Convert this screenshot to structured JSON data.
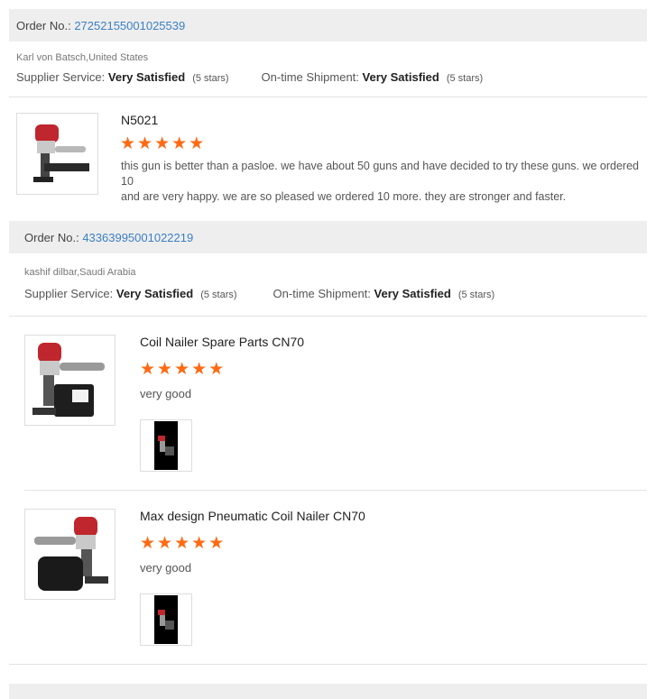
{
  "orders": [
    {
      "order_label": "Order No.:",
      "order_number": "27252155001025539",
      "buyer": "Karl von Batsch,United States",
      "supplier_label": "Supplier Service:",
      "supplier_value": "Very Satisfied",
      "supplier_stars": "(5 stars)",
      "shipment_label": "On-time Shipment:",
      "shipment_value": "Very Satisfied",
      "shipment_stars": "(5 stars)",
      "products": [
        {
          "name": "N5021",
          "rating": 5,
          "review_lines": [
            "this gun is better than a pasloe. we have about 50 guns and have decided to try these guns. we ordered 10",
            "and are very happy. we are so pleased we ordered 10 more. they are stronger and faster."
          ]
        }
      ]
    },
    {
      "order_label": "Order No.:",
      "order_number": "43363995001022219",
      "buyer": "kashif dilbar,Saudi Arabia",
      "supplier_label": "Supplier Service:",
      "supplier_value": "Very Satisfied",
      "supplier_stars": "(5 stars)",
      "shipment_label": "On-time Shipment:",
      "shipment_value": "Very Satisfied",
      "shipment_stars": "(5 stars)",
      "products": [
        {
          "name": "Coil Nailer Spare Parts CN70",
          "rating": 5,
          "review": "very good"
        },
        {
          "name": "Max design Pneumatic Coil Nailer CN70",
          "rating": 5,
          "review": "very good"
        }
      ]
    }
  ],
  "star_glyph": "★",
  "colors": {
    "link": "#3a7fc4",
    "star": "#ff6a13",
    "header_bg": "#eeeeee",
    "nailer_red": "#c0262d"
  }
}
